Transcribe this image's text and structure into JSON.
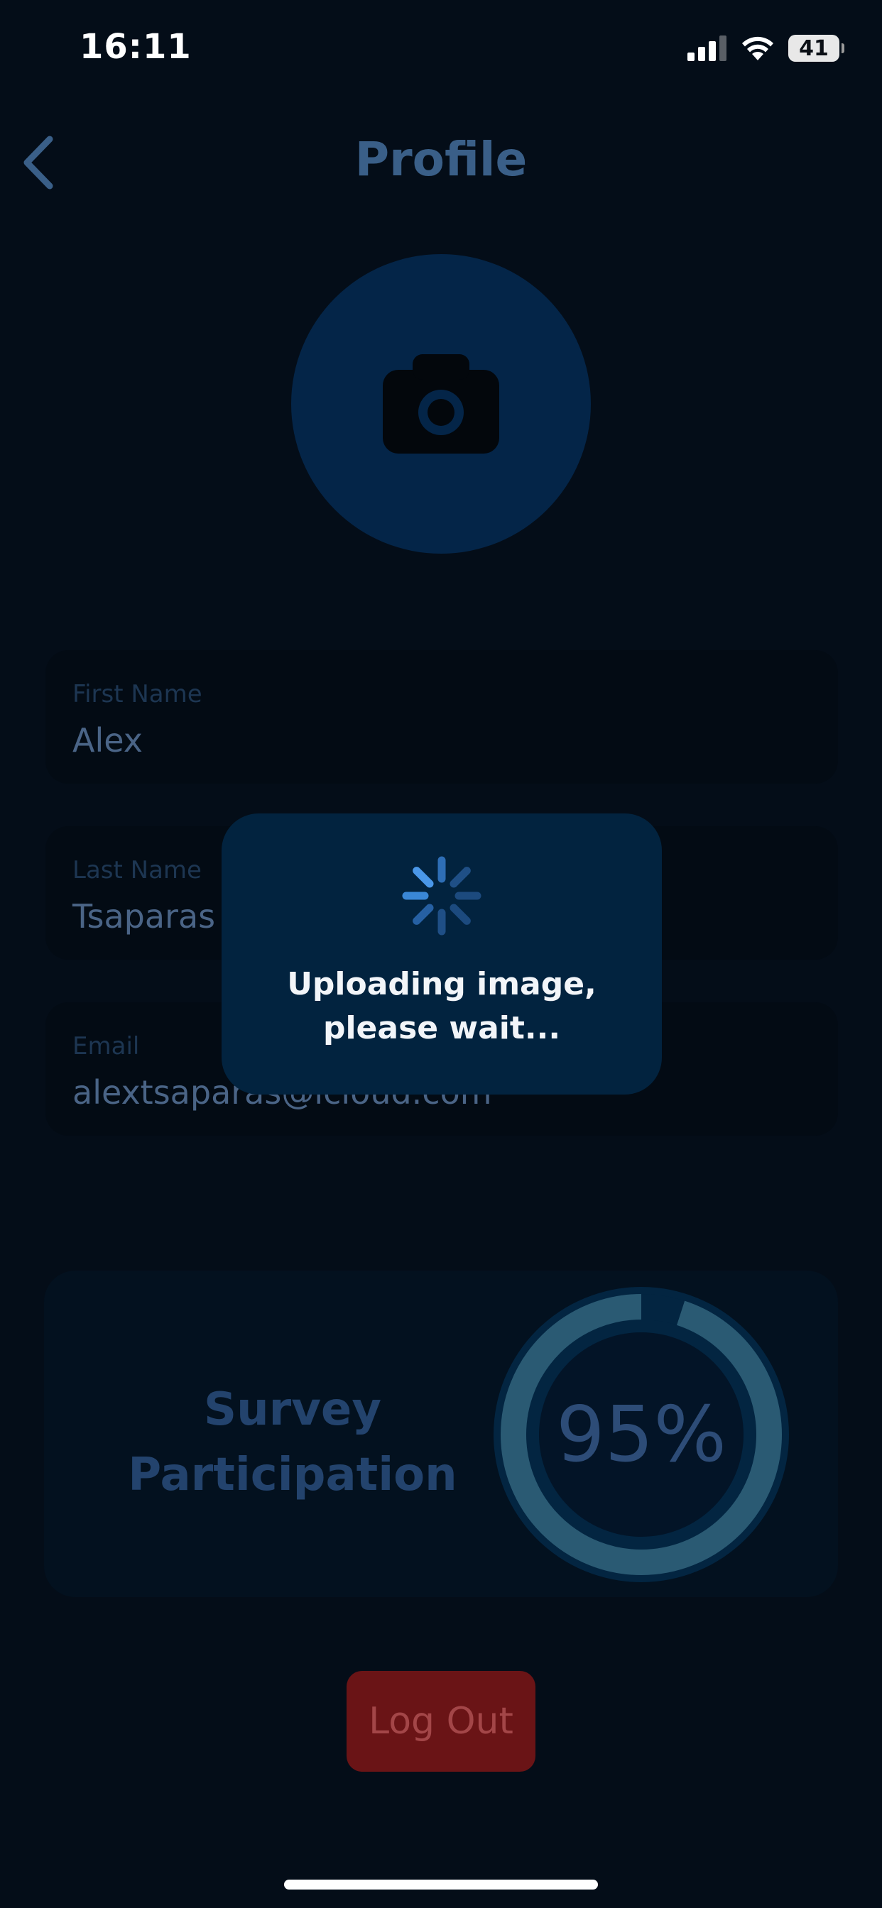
{
  "status_bar": {
    "time": "16:11",
    "battery": "41"
  },
  "header": {
    "title": "Profile",
    "back_icon": "chevron-left-icon"
  },
  "avatar": {
    "icon": "camera-icon"
  },
  "fields": {
    "first_name": {
      "label": "First Name",
      "value": "Alex"
    },
    "last_name": {
      "label": "Last Name",
      "value": "Tsaparas"
    },
    "email": {
      "label": "Email",
      "value": "alextsaparas@icloud.com"
    }
  },
  "survey": {
    "label": "Survey Participation",
    "percent_text": "95%",
    "progress": 0.95
  },
  "logout": {
    "label": "Log Out"
  },
  "loader": {
    "line1": "Uploading image,",
    "line2": "please wait..."
  },
  "colors": {
    "background": "#040d18",
    "accent_blue": "#3a5f88",
    "logout_red": "#6a1416",
    "ring": "#2a5a73"
  }
}
